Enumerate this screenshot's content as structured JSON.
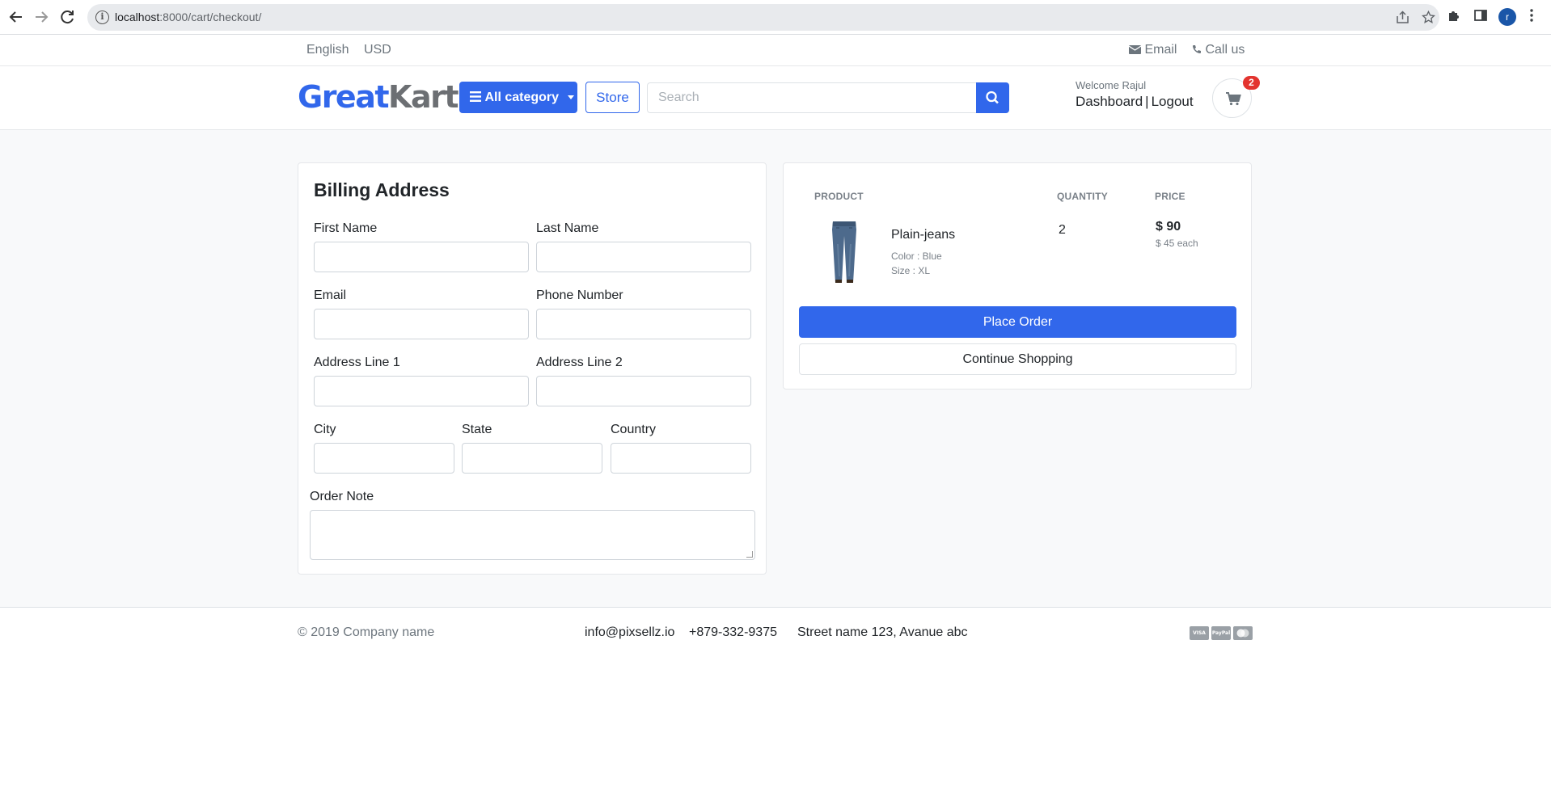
{
  "browser": {
    "url_host": "localhost",
    "url_path": ":8000/cart/checkout/",
    "profile_initial": "r"
  },
  "topbar": {
    "language": "English",
    "currency": "USD",
    "email": "Email",
    "call": "Call us"
  },
  "header": {
    "logo_great": "Great",
    "logo_kart": "Kart",
    "all_category": "All category",
    "store": "Store",
    "search_placeholder": "Search",
    "welcome": "Welcome Rajul",
    "dashboard": "Dashboard",
    "separator": "|",
    "logout": "Logout",
    "cart_count": "2"
  },
  "billing": {
    "title": "Billing Address",
    "first_name": "First Name",
    "last_name": "Last Name",
    "email": "Email",
    "phone": "Phone Number",
    "address1": "Address Line 1",
    "address2": "Address Line 2",
    "city": "City",
    "state": "State",
    "country": "Country",
    "order_note": "Order Note"
  },
  "order": {
    "col_product": "PRODUCT",
    "col_quantity": "QUANTITY",
    "col_price": "PRICE",
    "item": {
      "name": "Plain-jeans",
      "color": "Color : Blue",
      "size": "Size : XL",
      "quantity": "2",
      "total": "$ 90",
      "each": "$ 45 each"
    },
    "place_order": "Place Order",
    "continue_shopping": "Continue Shopping"
  },
  "footer": {
    "copyright": "© 2019 Company name",
    "email": "info@pixsellz.io",
    "phone": "+879-332-9375",
    "address": "Street name 123, Avanue abc",
    "payments": [
      "VISA",
      "PayPal",
      "MC"
    ]
  },
  "colors": {
    "primary": "#3167eb",
    "badge": "#e3342f",
    "muted": "#6c757d"
  }
}
